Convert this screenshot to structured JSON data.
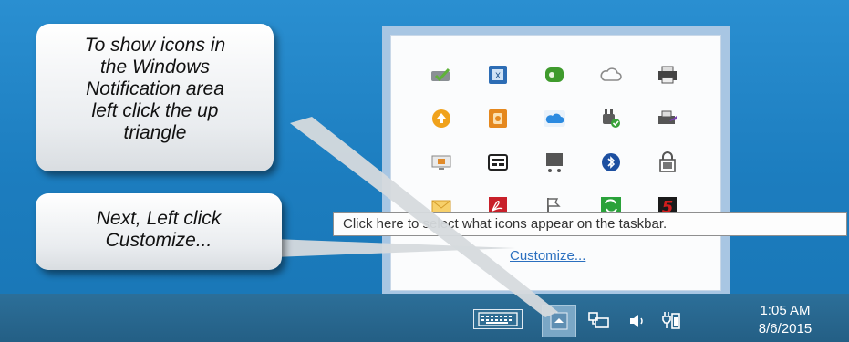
{
  "callouts": {
    "first": {
      "lines": [
        "To show icons in",
        "the Windows",
        "Notification area",
        "left click the up",
        "triangle"
      ]
    },
    "second": {
      "lines": [
        "Next, Left click",
        "Customize..."
      ]
    }
  },
  "tray_popup": {
    "icons": [
      {
        "name": "sync-check-icon",
        "color": "#6fae3a"
      },
      {
        "name": "excel-sheet-icon",
        "color": "#2d6db5"
      },
      {
        "name": "chat-bubble-icon",
        "color": "#3f9b2d"
      },
      {
        "name": "cloud-outline-icon",
        "color": "#8a8a8a"
      },
      {
        "name": "printer-icon",
        "color": "#3b3b3b"
      },
      {
        "name": "orange-up-arrow-icon",
        "color": "#f0a21c"
      },
      {
        "name": "orange-square-icon",
        "color": "#e5881e"
      },
      {
        "name": "onedrive-cloud-icon",
        "color": "#2b8ae0"
      },
      {
        "name": "power-check-icon",
        "color": "#5c5c5c"
      },
      {
        "name": "printer-arrow-icon",
        "color": "#444"
      },
      {
        "name": "monitor-orange-icon",
        "color": "#d28a2a"
      },
      {
        "name": "card-reader-icon",
        "color": "#222"
      },
      {
        "name": "display-stand-icon",
        "color": "#555"
      },
      {
        "name": "bluetooth-icon",
        "color": "#1d4fa0"
      },
      {
        "name": "bitlocker-icon",
        "color": "#555"
      },
      {
        "name": "envelope-icon",
        "color": "#e8b53a"
      },
      {
        "name": "acrobat-icon",
        "color": "#c8202a"
      },
      {
        "name": "flag-icon",
        "color": "#666"
      },
      {
        "name": "green-sync-icon",
        "color": "#2aa23a"
      },
      {
        "name": "red-five-icon",
        "color": "#d21d1d"
      }
    ],
    "customize_label": "Customize..."
  },
  "tooltip": {
    "text": "Click here to select what icons appear on the taskbar."
  },
  "taskbar": {
    "time": "1:05 AM",
    "date": "8/6/2015",
    "icons": [
      "keyboard-icon",
      "show-hidden-icons-up-triangle-icon",
      "network-icon",
      "volume-icon",
      "battery-icon"
    ]
  },
  "colors": {
    "desktop": "#1f7fc0",
    "taskbar": "#27658d",
    "popup_border": "#a8c6e3",
    "link": "#2a6fbf"
  }
}
